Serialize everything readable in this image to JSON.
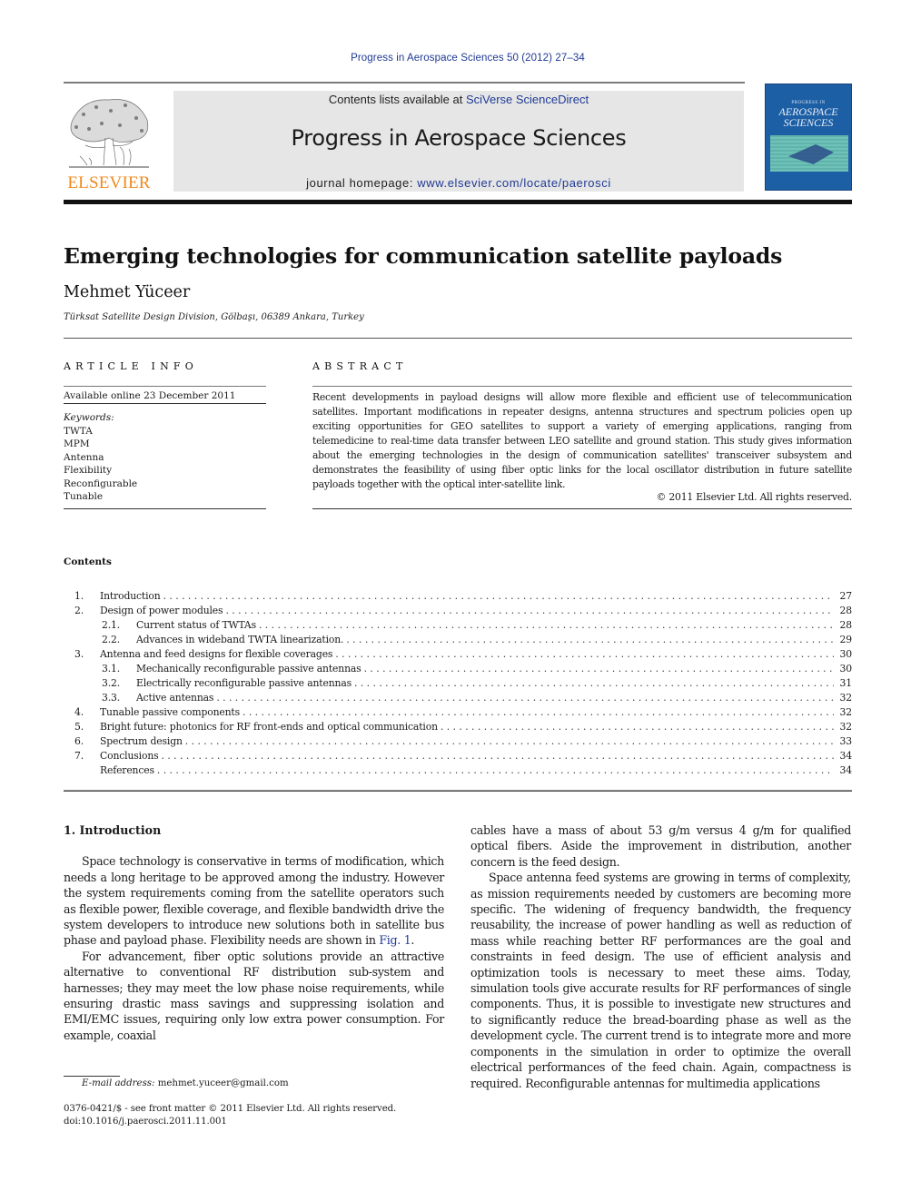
{
  "running_head": "Progress in Aerospace Sciences 50 (2012) 27–34",
  "header": {
    "publisher_wordmark": "ELSEVIER",
    "contents_prefix": "Contents lists available at ",
    "contents_link": "SciVerse ScienceDirect",
    "journal_title": "Progress in Aerospace Sciences",
    "homepage_prefix": "journal homepage: ",
    "homepage_link": "www.elsevier.com/locate/paerosci",
    "cover": {
      "small_line": "PROGRESS IN",
      "title_line1": "AEROSPACE",
      "title_line2": "SCIENCES"
    },
    "colors": {
      "link": "#1f3a93",
      "elsevier_orange": "#f08a1c",
      "banner_bg": "#e6e6e6",
      "cover_blue": "#1d5fa5"
    }
  },
  "article": {
    "title": "Emerging technologies for communication satellite payloads",
    "author": "Mehmet Yüceer",
    "affiliation": "Türksat Satellite Design Division, Gölbaşı, 06389 Ankara, Turkey"
  },
  "article_info": {
    "heading": "ARTICLE INFO",
    "available_online": "Available online 23 December 2011",
    "keywords_label": "Keywords:",
    "keywords": [
      "TWTA",
      "MPM",
      "Antenna",
      "Flexibility",
      "Reconfigurable",
      "Tunable"
    ]
  },
  "abstract": {
    "heading": "ABSTRACT",
    "text": "Recent developments in payload designs will allow more flexible and efficient use of telecommunication satellites. Important modifications in repeater designs, antenna structures and spectrum policies open up exciting opportunities for GEO satellites to support a variety of emerging applications, ranging from telemedicine to real-time data transfer between LEO satellite and ground station. This study gives information about the emerging technologies in the design of communication satellites' transceiver subsystem and demonstrates the feasibility of using fiber optic links for the local oscillator distribution in future satellite payloads together with the optical inter-satellite link.",
    "copyright": "© 2011 Elsevier Ltd. All rights reserved."
  },
  "contents": {
    "heading": "Contents",
    "items": [
      {
        "num": "1.",
        "title": "Introduction",
        "page": "27",
        "level": 1
      },
      {
        "num": "2.",
        "title": "Design of power modules",
        "page": "28",
        "level": 1
      },
      {
        "num": "2.1.",
        "title": "Current status of TWTAs",
        "page": "28",
        "level": 2
      },
      {
        "num": "2.2.",
        "title": "Advances in wideband TWTA linearization.",
        "page": "29",
        "level": 2
      },
      {
        "num": "3.",
        "title": "Antenna and feed designs for flexible coverages",
        "page": "30",
        "level": 1
      },
      {
        "num": "3.1.",
        "title": "Mechanically reconfigurable passive antennas",
        "page": "30",
        "level": 2
      },
      {
        "num": "3.2.",
        "title": "Electrically reconfigurable passive antennas",
        "page": "31",
        "level": 2
      },
      {
        "num": "3.3.",
        "title": "Active antennas",
        "page": "32",
        "level": 2
      },
      {
        "num": "4.",
        "title": "Tunable passive components",
        "page": "32",
        "level": 1
      },
      {
        "num": "5.",
        "title": "Bright future: photonics for RF front-ends and optical communication",
        "page": "32",
        "level": 1
      },
      {
        "num": "6.",
        "title": "Spectrum design",
        "page": "33",
        "level": 1
      },
      {
        "num": "7.",
        "title": "Conclusions",
        "page": "34",
        "level": 1
      },
      {
        "num": "",
        "title": "References",
        "page": "34",
        "level": 1
      }
    ]
  },
  "body": {
    "intro_heading": "1.  Introduction",
    "left_paragraphs": [
      {
        "before_link": "Space technology is conservative in terms of modification, which needs a long heritage to be approved among the industry. However the system requirements coming from the satellite operators such as flexible power, flexible coverage, and flexible bandwidth drive the system developers to introduce new solutions both in satellite bus phase and payload phase. Flexibility needs are shown in ",
        "link": "Fig. 1",
        "after_link": "."
      },
      {
        "before_link": "For advancement, fiber optic solutions provide an attractive alternative to conventional RF distribution sub-system and harnesses; they may meet the low phase noise requirements, while ensuring drastic mass savings and suppressing isolation and EMI/EMC issues, requiring only low extra power consumption. For example, coaxial",
        "link": "",
        "after_link": ""
      }
    ],
    "right_paragraphs": [
      "cables have a mass of about 53 g/m versus 4 g/m for qualified optical fibers. Aside the improvement in distribution, another concern is the feed design.",
      "Space antenna feed systems are growing in terms of complexity, as mission requirements needed by customers are becoming more specific. The widening of frequency bandwidth, the frequency reusability, the increase of power handling as well as reduction of mass while reaching better RF performances are the goal and constraints in feed design. The use of efficient analysis and optimization tools is necessary to meet these aims. Today, simulation tools give accurate results for RF performances of single components. Thus, it is possible to investigate new structures and to significantly reduce the bread-boarding phase as well as the development cycle. The current trend is to integrate more and more components in the simulation in order to optimize the overall electrical performances of the feed chain. Again, compactness is required. Reconfigurable antennas for multimedia applications"
    ]
  },
  "footer": {
    "email_label": "E-mail address:",
    "email": "mehmet.yuceer@gmail.com",
    "issn_line": "0376-0421/$ - see front matter © 2011 Elsevier Ltd. All rights reserved.",
    "doi_line": "doi:10.1016/j.paerosci.2011.11.001"
  }
}
